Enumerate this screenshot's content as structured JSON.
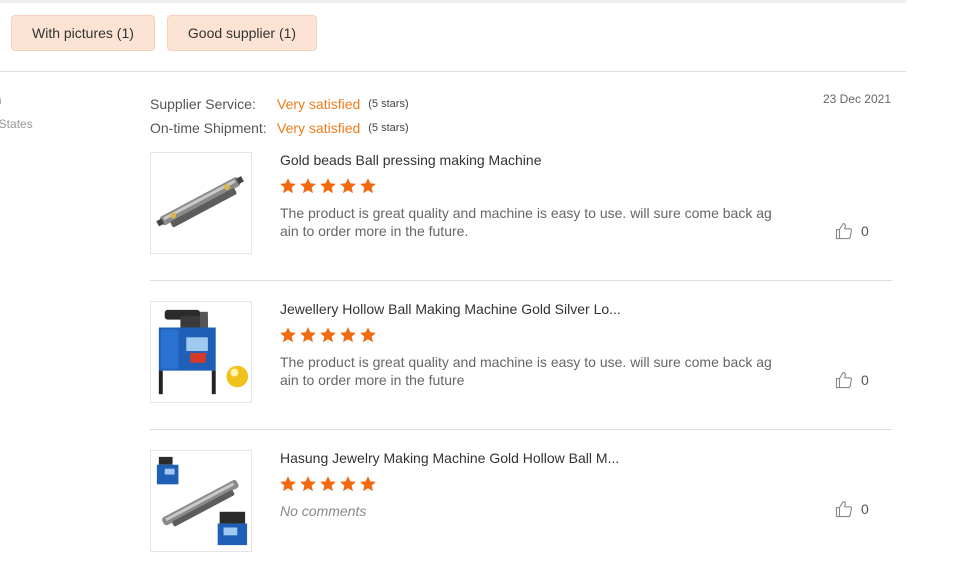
{
  "filters": [
    {
      "label": "With pictures (1)"
    },
    {
      "label": "Good supplier (1)"
    }
  ],
  "reviewer": {
    "name": "n",
    "country": "ited States"
  },
  "ratings": [
    {
      "label": "Supplier Service:",
      "value": "Very satisfied",
      "stars": "(5 stars)"
    },
    {
      "label": "On-time Shipment:",
      "value": "Very satisfied",
      "stars": "(5 stars)"
    }
  ],
  "date": "23 Dec 2021",
  "items": [
    {
      "title": "Gold beads Ball pressing making Machine",
      "rating": 5,
      "comment": "The product is great quality and machine is easy to use. will sure come back again to order more in the future.",
      "likes": "0",
      "thumb_icon": "bead-roller-machine-image"
    },
    {
      "title": "Jewellery Hollow Ball Making Machine Gold Silver Lo...",
      "rating": 5,
      "comment": "The product is great quality and machine is easy to use. will sure come back again to order more in the future",
      "likes": "0",
      "thumb_icon": "hollow-ball-machine-image"
    },
    {
      "title": "Hasung Jewelry Making Machine Gold Hollow Ball M...",
      "rating": 5,
      "comment": "No comments",
      "comment_empty": true,
      "likes": "0",
      "thumb_icon": "jewelry-machine-set-image"
    }
  ],
  "colors": {
    "accent": "#f07c1b",
    "filter_bg": "#fde3d3",
    "star": "#f26a10"
  }
}
